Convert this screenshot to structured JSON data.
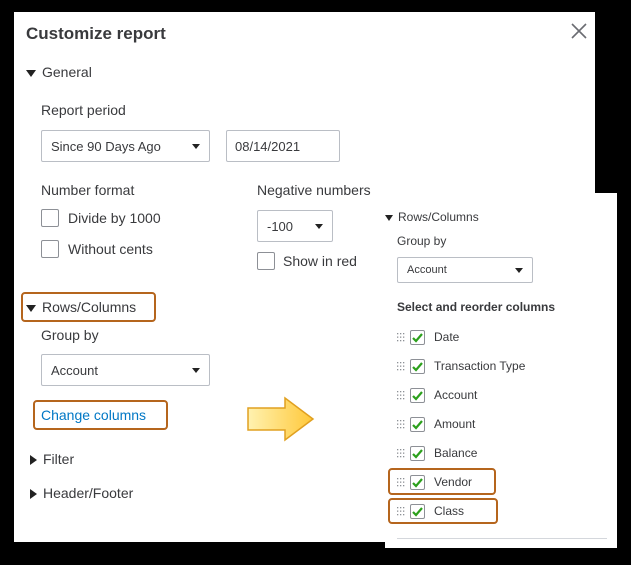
{
  "dialog": {
    "title": "Customize report",
    "general": {
      "section_label": "General",
      "report_period_label": "Report period",
      "report_period_value": "Since 90 Days Ago",
      "date_value": "08/14/2021",
      "number_format_label": "Number format",
      "divide_by_1000_label": "Divide by 1000",
      "without_cents_label": "Without cents",
      "negative_numbers_label": "Negative numbers",
      "negative_numbers_value": "-100",
      "show_in_red_label": "Show in red"
    },
    "rows_columns": {
      "section_label": "Rows/Columns",
      "group_by_label": "Group by",
      "group_by_value": "Account",
      "change_columns_label": "Change columns"
    },
    "filter": {
      "section_label": "Filter"
    },
    "header_footer": {
      "section_label": "Header/Footer"
    }
  },
  "expanded_panel": {
    "section_label": "Rows/Columns",
    "group_by_label": "Group by",
    "group_by_value": "Account",
    "reorder_label": "Select and reorder columns",
    "columns": [
      {
        "label": "Date",
        "checked": true
      },
      {
        "label": "Transaction Type",
        "checked": true
      },
      {
        "label": "Account",
        "checked": true
      },
      {
        "label": "Amount",
        "checked": true
      },
      {
        "label": "Balance",
        "checked": true
      },
      {
        "label": "Vendor",
        "checked": true
      },
      {
        "label": "Class",
        "checked": true
      }
    ]
  },
  "colors": {
    "highlight": "#b5651d",
    "link": "#0077c5",
    "check": "#2ca01c",
    "arrow_fill": "#ffd966",
    "arrow_stroke": "#e0a020"
  }
}
